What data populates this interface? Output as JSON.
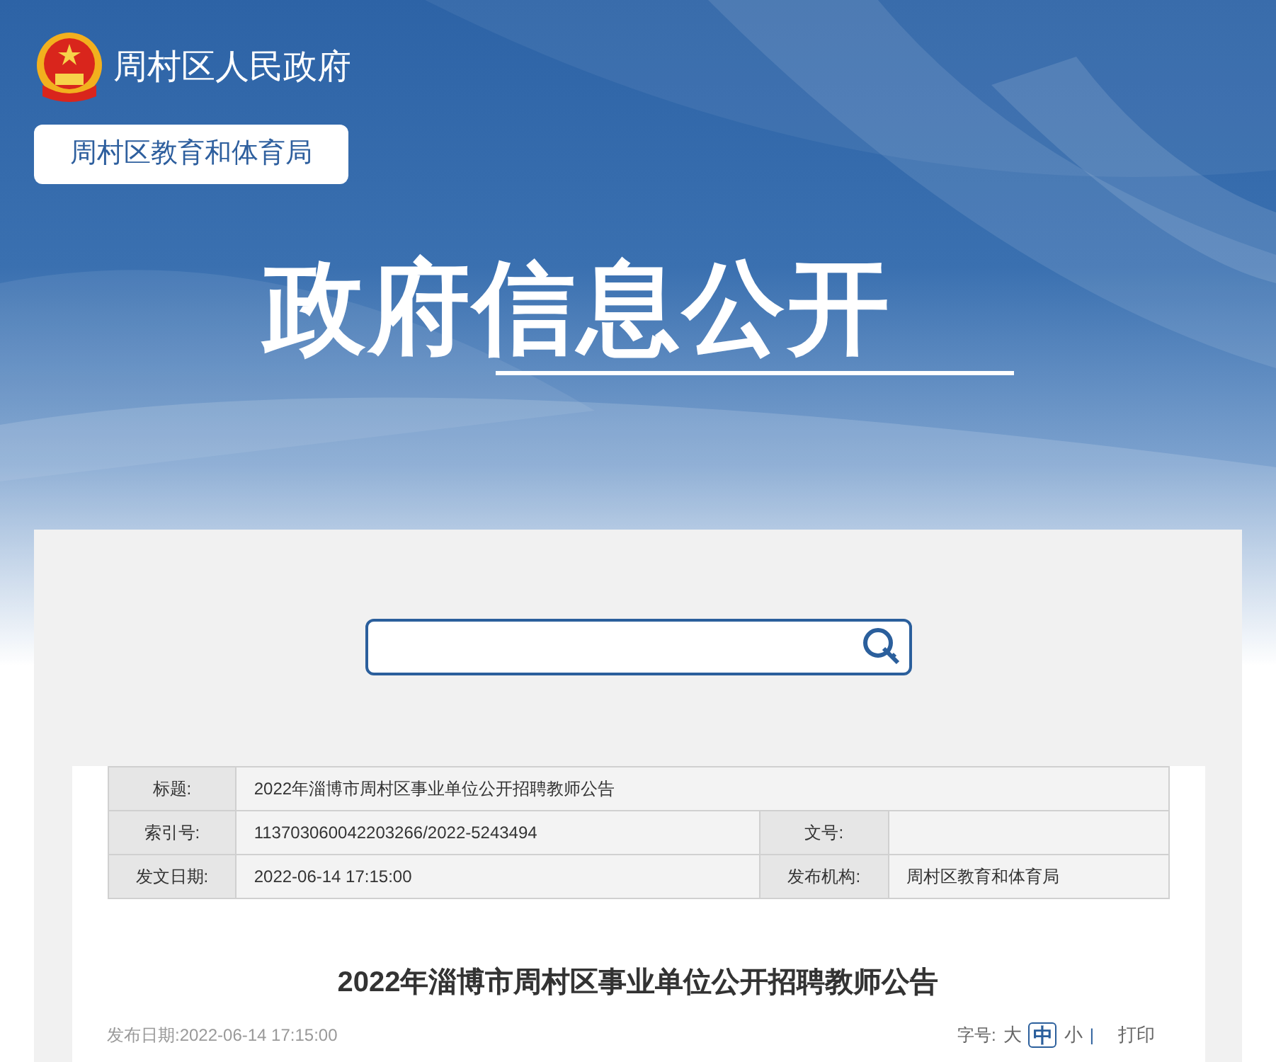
{
  "site": {
    "name": "周村区人民政府",
    "department": "周村区教育和体育局"
  },
  "banner": {
    "title": "政府信息公开"
  },
  "info_table": {
    "rows": [
      {
        "cells": [
          {
            "label": "标题:",
            "value": "2022年淄博市周村区事业单位公开招聘教师公告"
          }
        ]
      },
      {
        "cells": [
          {
            "label": "索引号:",
            "value": "113703060042203266/2022-5243494"
          },
          {
            "label": "文号:"
          }
        ]
      },
      {
        "cells": [
          {
            "label": "发文日期:",
            "value": "2022-06-14 17:15:00"
          },
          {
            "label": "发布机构:",
            "value": "周村区教育和体育局"
          }
        ]
      }
    ]
  },
  "article": {
    "title": "2022年淄博市周村区事业单位公开招聘教师公告",
    "publish_date": "发布日期:2022-06-14 17:15:00",
    "font_size_label": "字号:",
    "font_sizes": [
      {
        "label": "大",
        "selected": false
      },
      {
        "label": "中",
        "selected": true
      },
      {
        "label": "小",
        "selected": false
      }
    ],
    "separator": "|",
    "print": "打印"
  }
}
